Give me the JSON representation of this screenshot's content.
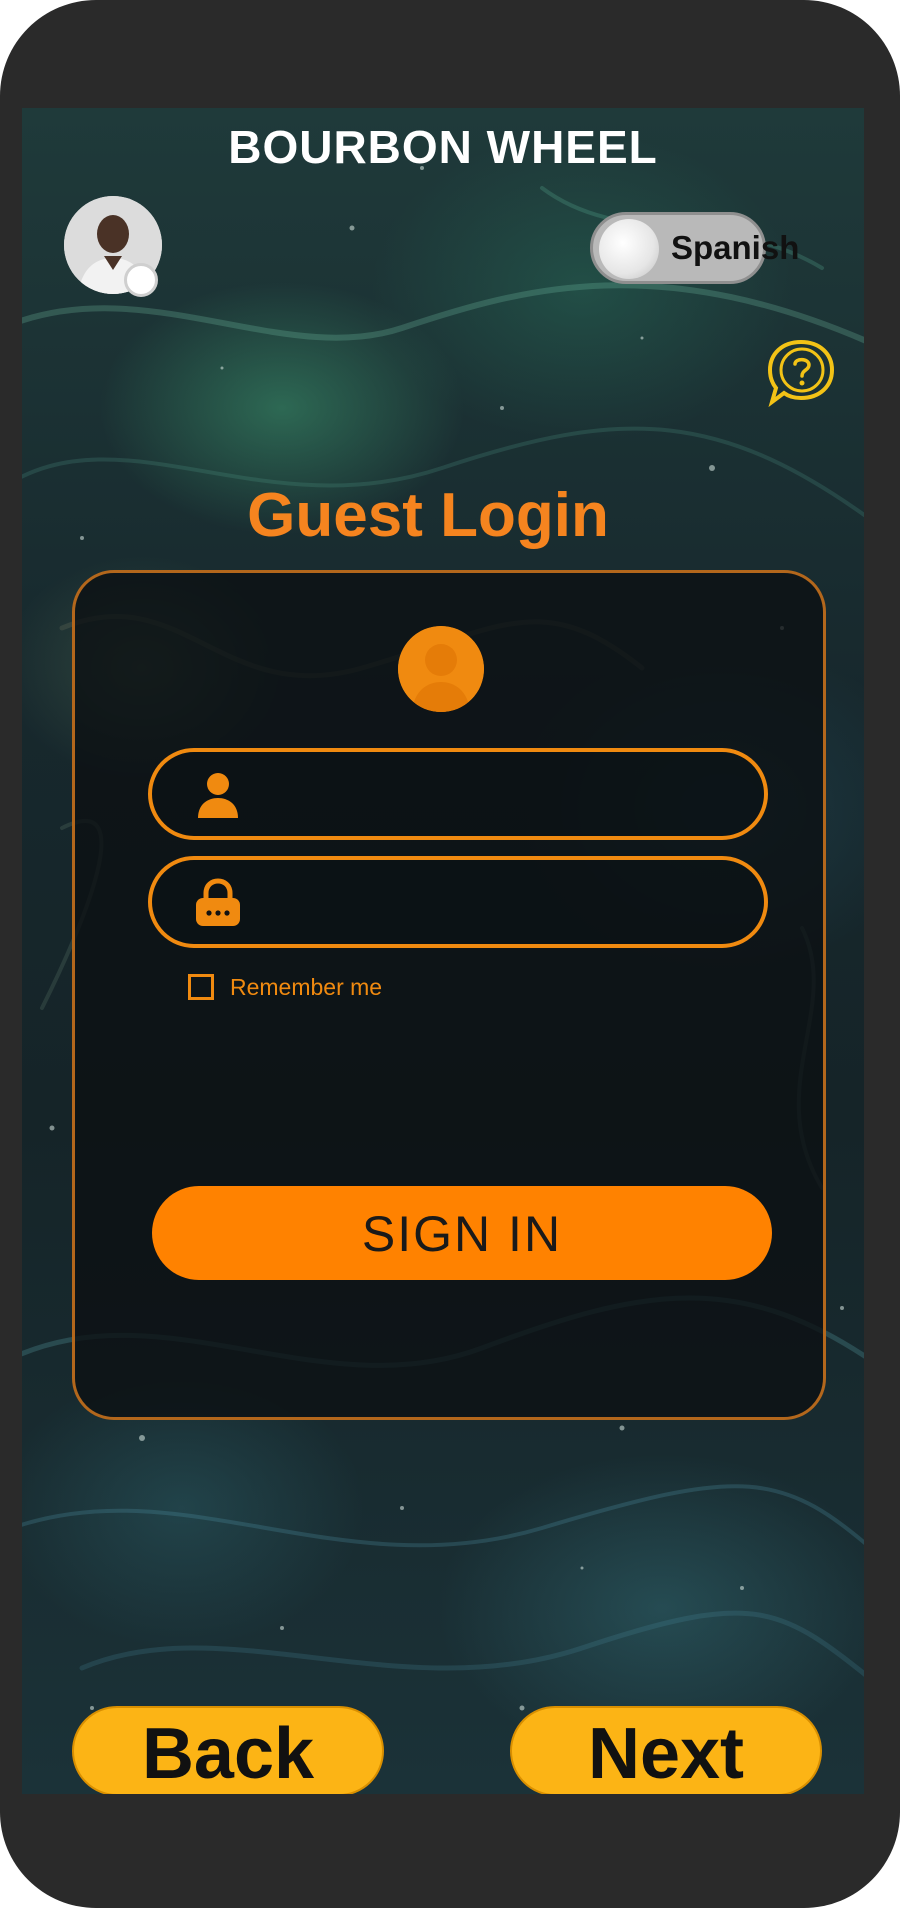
{
  "app": {
    "title": "BOURBON WHEEL"
  },
  "header": {
    "language_toggle": {
      "label": "Spanish"
    },
    "help_icon": "help-bubble-icon"
  },
  "main": {
    "title": "Guest Login",
    "username_field": {
      "value": "",
      "placeholder": ""
    },
    "password_field": {
      "value": "",
      "placeholder": ""
    },
    "remember_label": "Remember me",
    "remember_checked": false,
    "sign_in_label": "SIGN IN"
  },
  "footer": {
    "back_label": "Back",
    "next_label": "Next"
  },
  "colors": {
    "accent": "#ff8200",
    "accent_border": "#f08a10",
    "help": "#f3c316",
    "nav_button": "#fcb415",
    "frame": "#2a2a2a"
  }
}
